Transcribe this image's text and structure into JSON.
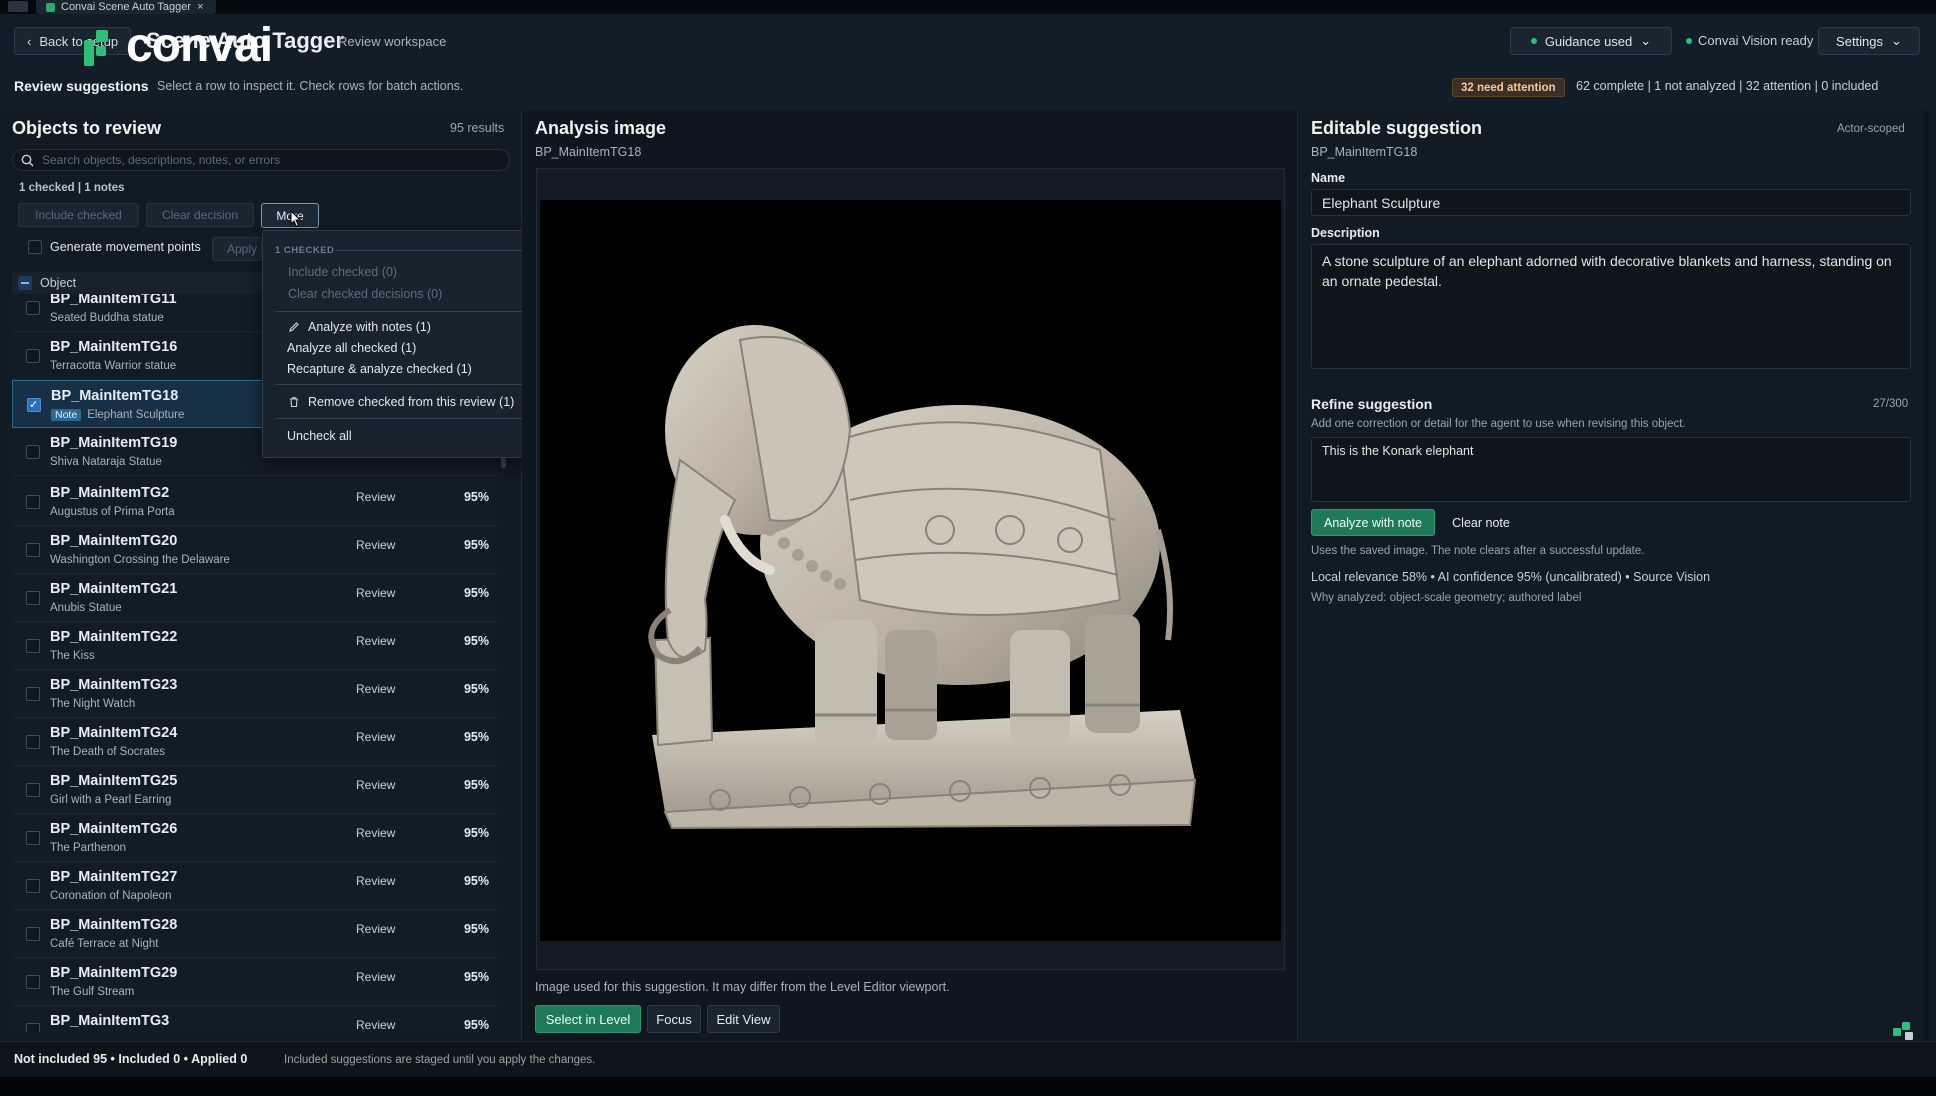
{
  "window": {
    "tab_title": "Convai Scene Auto Tagger",
    "tab_close": "×"
  },
  "header": {
    "back_label": "Back to setup",
    "logo_text": "convai",
    "app_title": "Scene Auto Tagger",
    "app_subtitle": "Review workspace",
    "guidance_label": "Guidance used",
    "vision_status": "Convai Vision ready",
    "settings_label": "Settings",
    "review_title": "Review suggestions",
    "review_subtitle": "Select a row to inspect it. Check rows for batch actions.",
    "attention_badge": "32 need attention",
    "stats": "62 complete  |  1 not analyzed  |  32 attention  |  0 included",
    "colors": {
      "accent_green": "#2fbf7a",
      "selection_blue": "#2b6a92"
    }
  },
  "left": {
    "title": "Objects to review",
    "results": "95 results",
    "search_placeholder": "Search objects, descriptions, notes, or errors",
    "checked_info": "1 checked  |  1 notes",
    "include_checked": "Include checked",
    "clear_decision": "Clear decision",
    "more": "More",
    "generate_movement": "Generate movement points",
    "apply": "Apply",
    "column_object": "Object",
    "rows": [
      {
        "name": "BP_MainItemTG11",
        "desc": "Seated Buddha statue",
        "status": "",
        "pct": "",
        "checked": false,
        "note": ""
      },
      {
        "name": "BP_MainItemTG16",
        "desc": "Terracotta Warrior statue",
        "status": "",
        "pct": "",
        "checked": false,
        "note": ""
      },
      {
        "name": "BP_MainItemTG18",
        "desc": "Elephant Sculpture",
        "status": "",
        "pct": "",
        "checked": true,
        "note": "Note"
      },
      {
        "name": "BP_MainItemTG19",
        "desc": "Shiva Nataraja Statue",
        "status": "",
        "pct": "",
        "checked": false,
        "note": ""
      },
      {
        "name": "BP_MainItemTG2",
        "desc": "Augustus of Prima Porta",
        "status": "Review",
        "pct": "95%",
        "checked": false,
        "note": ""
      },
      {
        "name": "BP_MainItemTG20",
        "desc": "Washington Crossing the Delaware",
        "status": "Review",
        "pct": "95%",
        "checked": false,
        "note": ""
      },
      {
        "name": "BP_MainItemTG21",
        "desc": "Anubis Statue",
        "status": "Review",
        "pct": "95%",
        "checked": false,
        "note": ""
      },
      {
        "name": "BP_MainItemTG22",
        "desc": "The Kiss",
        "status": "Review",
        "pct": "95%",
        "checked": false,
        "note": ""
      },
      {
        "name": "BP_MainItemTG23",
        "desc": "The Night Watch",
        "status": "Review",
        "pct": "95%",
        "checked": false,
        "note": ""
      },
      {
        "name": "BP_MainItemTG24",
        "desc": "The Death of Socrates",
        "status": "Review",
        "pct": "95%",
        "checked": false,
        "note": ""
      },
      {
        "name": "BP_MainItemTG25",
        "desc": "Girl with a Pearl Earring",
        "status": "Review",
        "pct": "95%",
        "checked": false,
        "note": ""
      },
      {
        "name": "BP_MainItemTG26",
        "desc": "The Parthenon",
        "status": "Review",
        "pct": "95%",
        "checked": false,
        "note": ""
      },
      {
        "name": "BP_MainItemTG27",
        "desc": "Coronation of Napoleon",
        "status": "Review",
        "pct": "95%",
        "checked": false,
        "note": ""
      },
      {
        "name": "BP_MainItemTG28",
        "desc": "Café Terrace at Night",
        "status": "Review",
        "pct": "95%",
        "checked": false,
        "note": ""
      },
      {
        "name": "BP_MainItemTG29",
        "desc": "The Gulf Stream",
        "status": "Review",
        "pct": "95%",
        "checked": false,
        "note": ""
      },
      {
        "name": "BP_MainItemTG3",
        "desc": "",
        "status": "Review",
        "pct": "95%",
        "checked": false,
        "note": ""
      }
    ]
  },
  "menu": {
    "header": "1 CHECKED",
    "include_checked": "Include checked (0)",
    "clear_checked": "Clear checked decisions (0)",
    "analyze_with_notes": "Analyze with notes (1)",
    "analyze_all": "Analyze all checked (1)",
    "recapture": "Recapture & analyze checked (1)",
    "remove": "Remove checked from this review (1)",
    "uncheck_all": "Uncheck all"
  },
  "center": {
    "title": "Analysis image",
    "subtitle": "BP_MainItemTG18",
    "caption": "Image used for this suggestion. It may differ from the Level Editor viewport.",
    "select_in_level": "Select in Level",
    "focus": "Focus",
    "edit_view": "Edit View"
  },
  "right": {
    "title": "Editable suggestion",
    "scope": "Actor-scoped",
    "subtitle": "BP_MainItemTG18",
    "name_label": "Name",
    "name_value": "Elephant Sculpture",
    "description_label": "Description",
    "description_value": "A stone sculpture of an elephant adorned with decorative blankets and harness, standing on an ornate pedestal.",
    "refine_title": "Refine suggestion",
    "refine_count": "27/300",
    "refine_help": "Add one correction or detail for the agent to use when revising this object.",
    "refine_value": "This is the Konark elephant",
    "analyze_with_note": "Analyze with note",
    "clear_note": "Clear note",
    "saved_note": "Uses the saved image. The note clears after a successful update.",
    "meta": "Local relevance 58%  •  AI confidence 95% (uncalibrated)  •  Source Vision",
    "why": "Why analyzed: object-scale geometry; authored label"
  },
  "footer": {
    "counts": "Not included 95  •  Included 0  •  Applied 0",
    "note": "Included suggestions are staged until you apply the changes."
  }
}
